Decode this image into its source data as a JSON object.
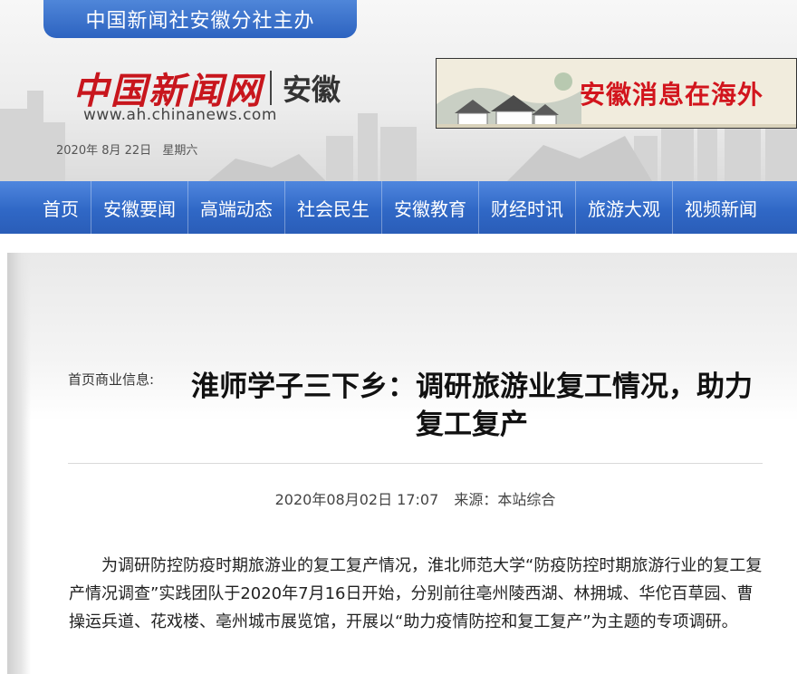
{
  "header": {
    "sponsor": "中国新闻社安徽分社主办",
    "logo_text": "中国新闻网",
    "region": "安徽",
    "url": "www.ah.chinanews.com",
    "date": "2020年 8月 22日",
    "weekday": "星期六",
    "banner_text": "安徽消息在海外"
  },
  "nav": {
    "items": [
      "首页",
      "安徽要闻",
      "高端动态",
      "社会民生",
      "安徽教育",
      "财经时讯",
      "旅游大观",
      "视频新闻"
    ]
  },
  "article": {
    "crumb": "首页商业信息:",
    "title": "淮师学子三下乡：调研旅游业复工情况，助力复工复产",
    "datetime": "2020年08月02日 17:07",
    "source": "来源：本站综合",
    "body": "为调研防控防疫时期旅游业的复工复产情况，淮北师范大学“防疫防控时期旅游行业的复工复产情况调查”实践团队于2020年7月16日开始，分别前往亳州陵西湖、林拥城、华佗百草园、曹操运兵道、花戏楼、亳州城市展览馆，开展以“助力疫情防控和复工复产”为主题的专项调研。"
  },
  "colors": {
    "nav_blue": "#3068c6",
    "logo_red": "#c8161d",
    "banner_red": "#d2151d"
  }
}
